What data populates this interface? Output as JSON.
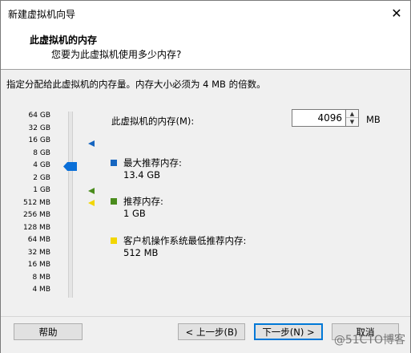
{
  "window": {
    "title": "新建虚拟机向导",
    "close_glyph": "✕"
  },
  "header": {
    "title": "此虚拟机的内存",
    "subtitle": "您要为此虚拟机使用多少内存?"
  },
  "instruction": "指定分配给此虚拟机的内存量。内存大小必须为 4 MB 的倍数。",
  "memory": {
    "label": "此虚拟机的内存(M):",
    "value": "4096",
    "unit": "MB"
  },
  "scale_labels": [
    "64 GB",
    "32 GB",
    "16 GB",
    "8 GB",
    "4 GB",
    "2 GB",
    "1 GB",
    "512 MB",
    "256 MB",
    "128 MB",
    "64 MB",
    "32 MB",
    "16 MB",
    "8 MB",
    "4 MB"
  ],
  "legend": {
    "max": {
      "title": "最大推荐内存:",
      "value": "13.4 GB",
      "color": "#1565c0"
    },
    "recommended": {
      "title": "推荐内存:",
      "value": "1 GB",
      "color": "#4a8c1c"
    },
    "guest_min": {
      "title": "客户机操作系统最低推荐内存:",
      "value": "512 MB",
      "color": "#f2d600"
    }
  },
  "buttons": {
    "help": "帮助",
    "back": "< 上一步(B)",
    "next": "下一步(N) >",
    "cancel": "取消"
  },
  "watermark": "@51CTO博客"
}
